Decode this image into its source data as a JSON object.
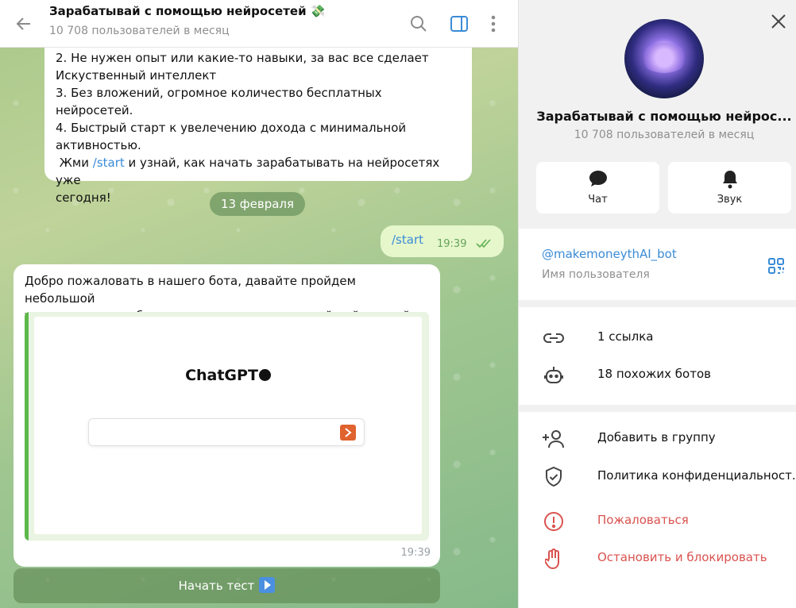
{
  "chat": {
    "title": "Зарабатывай с помощью нейросетей 💸",
    "subtitle": "10 708 пользователей в месяц"
  },
  "messages": {
    "top_lines": [
      "2. Не нужен опыт или какие-то навыки, за вас все сделает",
      "Искуственный интеллект",
      "3. Без вложений, огромное количество бесплатных нейросетей.",
      "4. Быстрый старт к увелечению дохода с минимальной",
      "активностью."
    ],
    "top_last_prefix": " Жми ",
    "top_last_link": "/start",
    "top_last_suffix": " и узнай, как начать зарабатывать на нейросетях уже",
    "top_last_line2": "сегодня!",
    "date_chip": "13 февраля",
    "outgoing": {
      "text": "/start",
      "time": "19:39"
    },
    "welcome_text_1": "Добро пожаловать в нашего бота, давайте пройдем небольшой",
    "welcome_text_2_plain": "тест ",
    "welcome_text_2_link": "для того чтобы понять ваш уровень знаний нейросетей.",
    "preview_title": "ChatGPT",
    "welcome_time": "19:39",
    "start_button": "Начать тест"
  },
  "info": {
    "name": "Зарабатывай с помощью нейрос...",
    "subtitle": "10 708 пользователей в месяц",
    "actions": [
      {
        "label": "Чат",
        "icon": "chat-bubble-icon"
      },
      {
        "label": "Звук",
        "icon": "bell-icon"
      }
    ],
    "username": "@makemoneythAI_bot",
    "username_label": "Имя пользователя",
    "links": [
      {
        "label": "1 ссылка",
        "icon": "link-icon"
      },
      {
        "label": "18 похожих ботов",
        "icon": "bot-icon"
      }
    ],
    "actions_list": [
      {
        "label": "Добавить в группу",
        "icon": "add-user-icon"
      },
      {
        "label": "Политика конфиденциальност...",
        "icon": "shield-check-icon"
      },
      {
        "label": "Пожаловаться",
        "icon": "report-icon"
      },
      {
        "label": "Остановить и блокировать",
        "icon": "hand-block-icon"
      }
    ]
  },
  "colors": {
    "accent": "#3a8bd6",
    "danger": "#d9534f",
    "outgoing_bubble": "#e6f7cc",
    "preview_bar": "#5cb84a"
  }
}
